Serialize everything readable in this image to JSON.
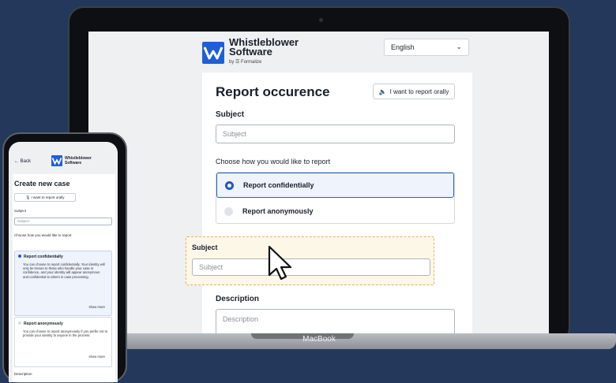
{
  "laptop": {
    "brand": "MacBook",
    "app": {
      "logo": {
        "name": "Whistleblower Software",
        "line1": "Whistleblower",
        "line2": "Software",
        "by": "by ☰ Formalize"
      },
      "language": {
        "selected": "English"
      },
      "form": {
        "title": "Report occurence",
        "oral_button": "I want to report orally",
        "subject_label": "Subject",
        "subject_placeholder": "Subject",
        "choice_label": "Choose how you would like to report",
        "options": [
          {
            "label": "Report confidentially",
            "selected": true
          },
          {
            "label": "Report anonymously",
            "selected": false
          }
        ],
        "drag_subject_label": "Subject",
        "drag_subject_placeholder": "Subject",
        "description_label": "Description",
        "description_placeholder": "Description"
      }
    }
  },
  "phone": {
    "back": "Back",
    "logo_line1": "Whistleblower",
    "logo_line2": "Software",
    "title": "Create new case",
    "oral_button": "I want to report orally",
    "subject_label": "Subject",
    "subject_placeholder": "Subject",
    "choice_label": "Choose how you would like to report",
    "options": [
      {
        "title": "Report confidentially",
        "body": "You can choose to report confidentially. Your identity will only be known to those who handle your case in confidence, and your identity will appear anonymous and confidential to others in case processing.",
        "more": "show more"
      },
      {
        "title": "Report anonymously",
        "body": "You can choose to report anonymously if you prefer not to provide your identity to anyone in the process.",
        "more": "show more"
      }
    ],
    "description_label": "Description"
  },
  "colors": {
    "background": "#23385a",
    "accent": "#2356c8",
    "drag_highlight": "#fdf7e8",
    "drag_border": "#e7b45a"
  },
  "icons": [
    "speaker-icon",
    "chevron-down-icon",
    "cursor-arrow-icon",
    "back-arrow-icon",
    "microphone-icon"
  ]
}
